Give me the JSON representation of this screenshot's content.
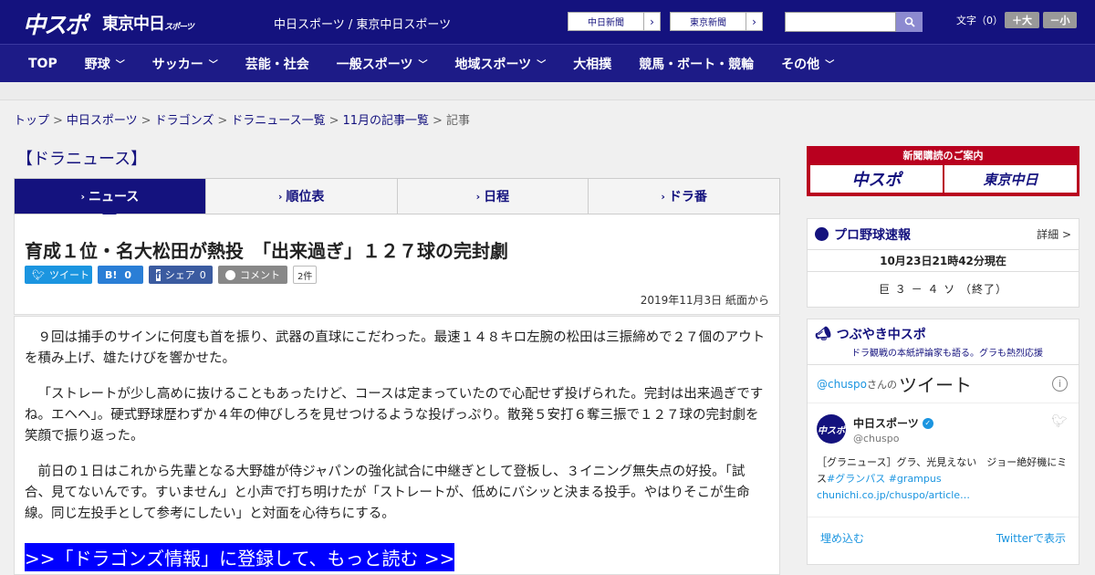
{
  "header": {
    "logo_main": "中スポ",
    "logo_tokyo": "東京中日",
    "logo_tokyo_small": "スポーツ",
    "site_links": "中日スポーツ / 東京中日スポーツ",
    "paper_btn_1": "中日新聞",
    "paper_btn_2": "東京新聞",
    "font_size_label": "文字（0）",
    "font_plus": "＋大",
    "font_minus": "－小"
  },
  "nav": [
    {
      "label": "TOP",
      "has_menu": false
    },
    {
      "label": "野球",
      "has_menu": true
    },
    {
      "label": "サッカー",
      "has_menu": true
    },
    {
      "label": "芸能・社会",
      "has_menu": false
    },
    {
      "label": "一般スポーツ",
      "has_menu": true
    },
    {
      "label": "地域スポーツ",
      "has_menu": true
    },
    {
      "label": "大相撲",
      "has_menu": false
    },
    {
      "label": "競馬・ボート・競輪",
      "has_menu": false
    },
    {
      "label": "その他",
      "has_menu": true
    }
  ],
  "breadcrumb": [
    "トップ",
    "中日スポーツ",
    "ドラゴンズ",
    "ドラニュース一覧",
    "11月の記事一覧",
    "記事"
  ],
  "section_title": "【ドラニュース】",
  "tabs": [
    {
      "label": "ニュース",
      "active": true
    },
    {
      "label": "順位表",
      "active": false
    },
    {
      "label": "日程",
      "active": false
    },
    {
      "label": "ドラ番",
      "active": false
    }
  ],
  "article": {
    "headline": "育成１位・名大松田が熱投　「出来過ぎ」１２７球の完封劇",
    "share": {
      "tweet": "ツイート",
      "hatena": "B!",
      "hatena_count": "0",
      "facebook": "シェア",
      "facebook_count": "0",
      "comment": "コメント",
      "comment_count": "2件"
    },
    "date": "2019年11月3日 紙面から",
    "paragraphs": [
      "９回は捕手のサインに何度も首を振り、武器の直球にこだわった。最速１４８キロ左腕の松田は三振締めで２７個のアウトを積み上げ、雄たけびを響かせた。",
      "「ストレートが少し高めに抜けることもあったけど、コースは定まっていたので心配せず投げられた。完封は出来過ぎですね。エヘヘ」。硬式野球歴わずか４年の伸びしろを見せつけるような投げっぷり。散発５安打６奪三振で１２７球の完封劇を笑顔で振り返った。",
      "前日の１日はこれから先輩となる大野雄が侍ジャパンの強化試合に中継ぎとして登板し、３イニング無失点の好投。「試合、見てないんです。すいません」と小声で打ち明けたが「ストレートが、低めにバシッと決まる投手。やはりそこが生命線。同じ左投手として参考にしたい」と対面を心待ちにする。"
    ],
    "promo": ">>「ドラゴンズ情報」に登録して、もっと読む >>"
  },
  "sidebar": {
    "subscribe_title": "新聞購読のご案内",
    "subscribe_logo_1": "中スポ",
    "subscribe_logo_2": "東京中日",
    "baseball": {
      "title": "プロ野球速報",
      "more": "詳細 >",
      "time": "10月23日21時42分現在",
      "score": "巨 ３ － ４ ソ （終了）"
    },
    "twitter": {
      "title": "つぶやき中スポ",
      "subtitle": "ドラ観戦の本紙評論家も語る。グラも熱烈応援",
      "handle": "@chuspo",
      "san": "さんの",
      "tweet_word": "ツイート",
      "name": "中日スポーツ",
      "user": "@chuspo",
      "text_1": "［グラニュース］グラ、光見えない　ジョー絶好機にミス",
      "tag_1": "#グランパス",
      "tag_2": "#grampus",
      "link": "chunichi.co.jp/chuspo/article…",
      "embed": "埋め込む",
      "view_on": "Twitterで表示"
    }
  }
}
